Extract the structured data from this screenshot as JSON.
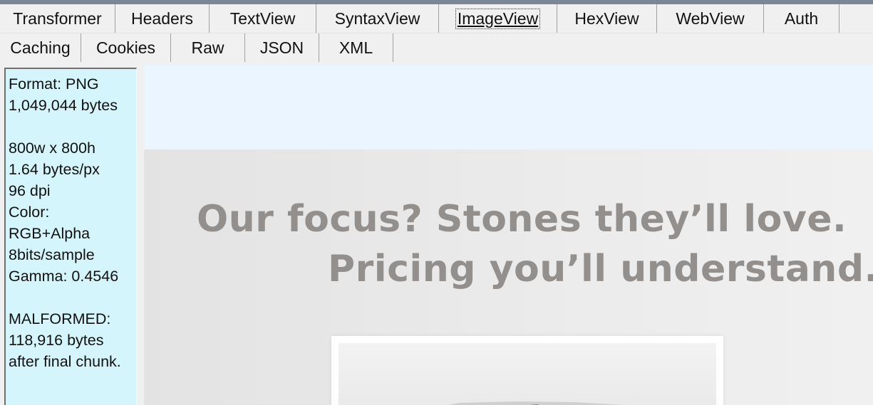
{
  "tabs": {
    "row1": [
      {
        "label": "Transformer",
        "selected": false
      },
      {
        "label": "Headers",
        "selected": false
      },
      {
        "label": "TextView",
        "selected": false
      },
      {
        "label": "SyntaxView",
        "selected": false
      },
      {
        "label": "ImageView",
        "selected": true
      },
      {
        "label": "HexView",
        "selected": false
      },
      {
        "label": "WebView",
        "selected": false
      },
      {
        "label": "Auth",
        "selected": false
      }
    ],
    "row2": [
      {
        "label": "Caching"
      },
      {
        "label": "Cookies"
      },
      {
        "label": "Raw"
      },
      {
        "label": "JSON"
      },
      {
        "label": "XML"
      }
    ]
  },
  "info": {
    "format": "Format: PNG",
    "size_bytes": "1,049,044 bytes",
    "dimensions": "800w x 800h",
    "bytes_per_px": "1.64 bytes/px",
    "dpi": "96 dpi",
    "color_label": "Color:",
    "color_value": "RGB+Alpha",
    "bits_per_sample": "8bits/sample",
    "gamma": "Gamma: 0.4546",
    "malformed_label": "MALFORMED:",
    "malformed_bytes": "118,916 bytes",
    "malformed_note": "after final chunk."
  },
  "preview": {
    "headline_line1": "Our focus? Stones they’ll love.",
    "headline_line2": "Pricing you’ll understand."
  },
  "colors": {
    "info_panel_bg": "#d4f5fb",
    "preview_bg": "#eaf5ff",
    "headline_text": "#938f8d"
  }
}
